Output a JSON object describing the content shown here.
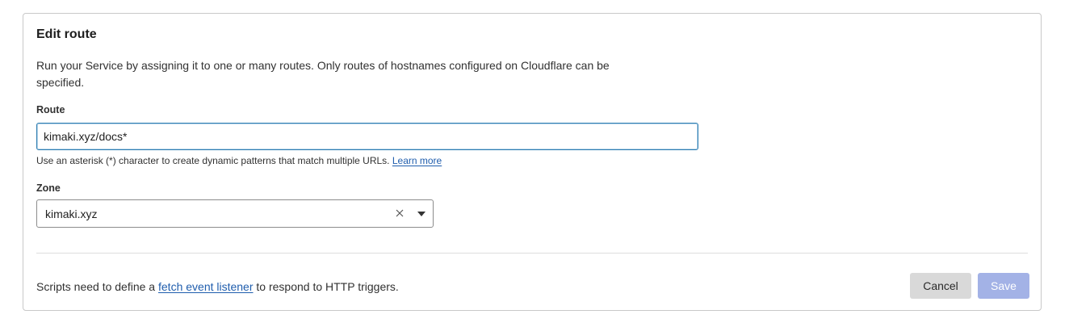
{
  "card": {
    "title": "Edit route",
    "description": "Run your Service by assigning it to one or many routes. Only routes of hostnames configured on Cloudflare can be specified."
  },
  "route": {
    "label": "Route",
    "value": "kimaki.xyz/docs*",
    "helper_text": "Use an asterisk (*) character to create dynamic patterns that match multiple URLs.",
    "learn_more": "Learn more"
  },
  "zone": {
    "label": "Zone",
    "selected": "kimaki.xyz",
    "clear_icon": "close-icon",
    "dropdown_icon": "chevron-down-icon"
  },
  "footer": {
    "text_before": "Scripts need to define a",
    "link": "fetch event listener",
    "text_after": "to respond to HTTP triggers.",
    "cancel_label": "Cancel",
    "save_label": "Save"
  },
  "colors": {
    "link": "#1f5dad",
    "input_focus_border": "#2c7cb0",
    "save_disabled_bg": "#a3b2e6",
    "cancel_bg": "#d9d9d9"
  }
}
